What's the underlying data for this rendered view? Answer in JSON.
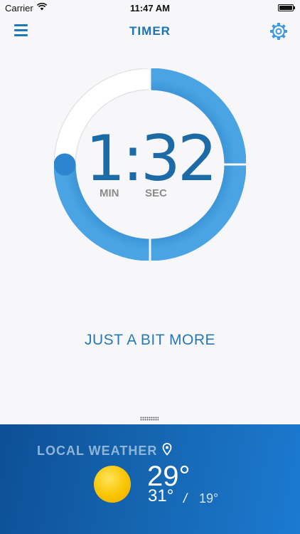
{
  "status_bar": {
    "carrier": "Carrier",
    "time": "11:47 AM"
  },
  "nav": {
    "title": "TIMER",
    "menu_icon": "hamburger-menu-icon",
    "settings_icon": "gear-icon"
  },
  "timer": {
    "minutes": "1",
    "separator": ":",
    "seconds": "32",
    "display": "1:32",
    "min_label": "MIN",
    "sec_label": "SEC",
    "progress_remaining_fraction": 0.75,
    "ring_color": "#2b86cf",
    "track_color": "#ffffff"
  },
  "message": "JUST A BIT MORE",
  "weather": {
    "heading": "LOCAL WEATHER",
    "location_icon": "location-pin-icon",
    "condition_icon": "sun-icon",
    "current_temp": "29°",
    "high_temp": "31°",
    "separator": "/",
    "low_temp": "19°"
  },
  "colors": {
    "accent": "#1c74b3",
    "weather_bg": "#1668b4",
    "sun": "#f9c400"
  }
}
